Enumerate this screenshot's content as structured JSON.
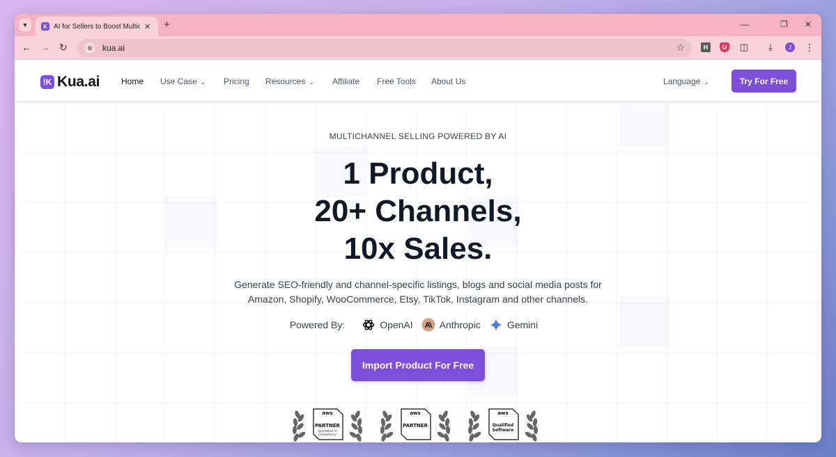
{
  "browser": {
    "tab_title": "AI for Sellers to Boost Multichannel",
    "url": "kua.ai",
    "profile_initial": "J",
    "ext_h_label": "H",
    "ext_shield_label": "U"
  },
  "nav": {
    "logo_mark": "!K",
    "logo_text": "Kua.ai",
    "items": [
      "Home",
      "Use Case",
      "Pricing",
      "Resources",
      "Affiliate",
      "Free Tools",
      "About Us"
    ],
    "language": "Language",
    "cta": "Try For Free"
  },
  "hero": {
    "eyebrow": "MULTICHANNEL SELLING POWERED BY AI",
    "headline": [
      "1 Product,",
      "20+ Channels,",
      "10x Sales."
    ],
    "subtext": [
      "Generate SEO-friendly and channel-specific listings, blogs and social media posts for",
      "Amazon, Shopify, WooCommerce, Etsy, TikTok, Instagram and other channels."
    ],
    "powered_label": "Powered By:",
    "providers": [
      "OpenAI",
      "Anthropic",
      "Gemini"
    ],
    "cta": "Import Product For Free"
  },
  "badges": [
    {
      "brand": "aws",
      "title": "PARTNER",
      "sub1": "Generative AI",
      "sub2": "Competency"
    },
    {
      "brand": "aws",
      "title": "PARTNER",
      "sub1": "",
      "sub2": ""
    },
    {
      "brand": "aws",
      "title": "Qualified",
      "sub1": "Software",
      "sub2": ""
    }
  ],
  "colors": {
    "accent": "#7c4fdb",
    "tabstrip": "#f6b3c1",
    "toolbar": "#fbd2db"
  }
}
